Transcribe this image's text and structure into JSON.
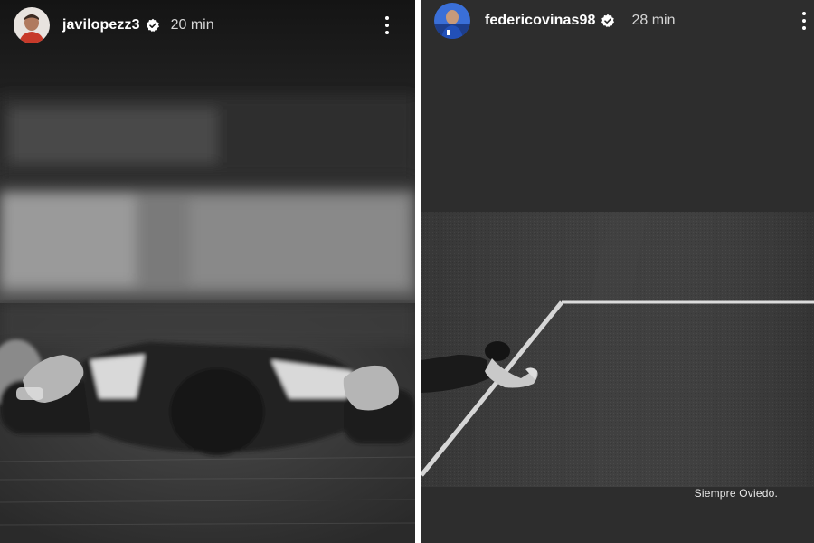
{
  "stories": [
    {
      "username": "javilopezz3",
      "verified": true,
      "timestamp": "20 min",
      "icons": [
        "avatar",
        "verified-badge-icon",
        "more-options-icon"
      ]
    },
    {
      "username": "federicovinas98",
      "verified": true,
      "timestamp": "28 min",
      "caption": "Siempre Oviedo.",
      "icons": [
        "avatar",
        "verified-badge-icon",
        "more-options-icon"
      ]
    }
  ],
  "colors": {
    "text": "#ffffff",
    "timestamp": "#d6d6d6",
    "divider": "#ffffff"
  }
}
